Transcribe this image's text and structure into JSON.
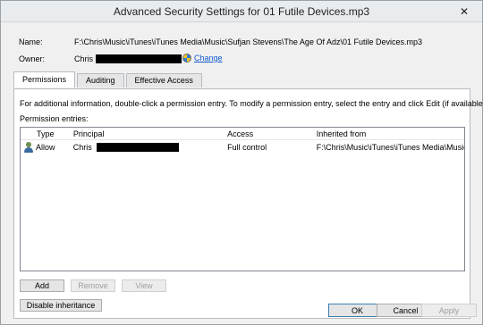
{
  "window": {
    "title": "Advanced Security Settings for 01 Futile Devices.mp3",
    "close_glyph": "✕"
  },
  "name_row": {
    "label": "Name:",
    "value": "F:\\Chris\\Music\\iTunes\\iTunes Media\\Music\\Sufjan Stevens\\The Age Of Adz\\01 Futile Devices.mp3"
  },
  "owner_row": {
    "label": "Owner:",
    "value": "Chris",
    "change_label": "Change"
  },
  "tabs": [
    {
      "label": "Permissions",
      "active": true
    },
    {
      "label": "Auditing",
      "active": false
    },
    {
      "label": "Effective Access",
      "active": false
    }
  ],
  "permissions": {
    "info": "For additional information, double-click a permission entry. To modify a permission entry, select the entry and click Edit (if available).",
    "entries_label": "Permission entries:",
    "columns": [
      "Type",
      "Principal",
      "Access",
      "Inherited from"
    ],
    "rows": [
      {
        "type": "Allow",
        "principal": "Chris",
        "access": "Full control",
        "inherited_from": "F:\\Chris\\Music\\iTunes\\iTunes Media\\Music..."
      }
    ],
    "add_label": "Add",
    "remove_label": "Remove",
    "view_label": "View",
    "disable_inheritance_label": "Disable inheritance"
  },
  "footer": {
    "ok_label": "OK",
    "cancel_label": "Cancel",
    "apply_label": "Apply"
  },
  "colors": {
    "link": "#0b57d0",
    "redaction": "#000000"
  }
}
